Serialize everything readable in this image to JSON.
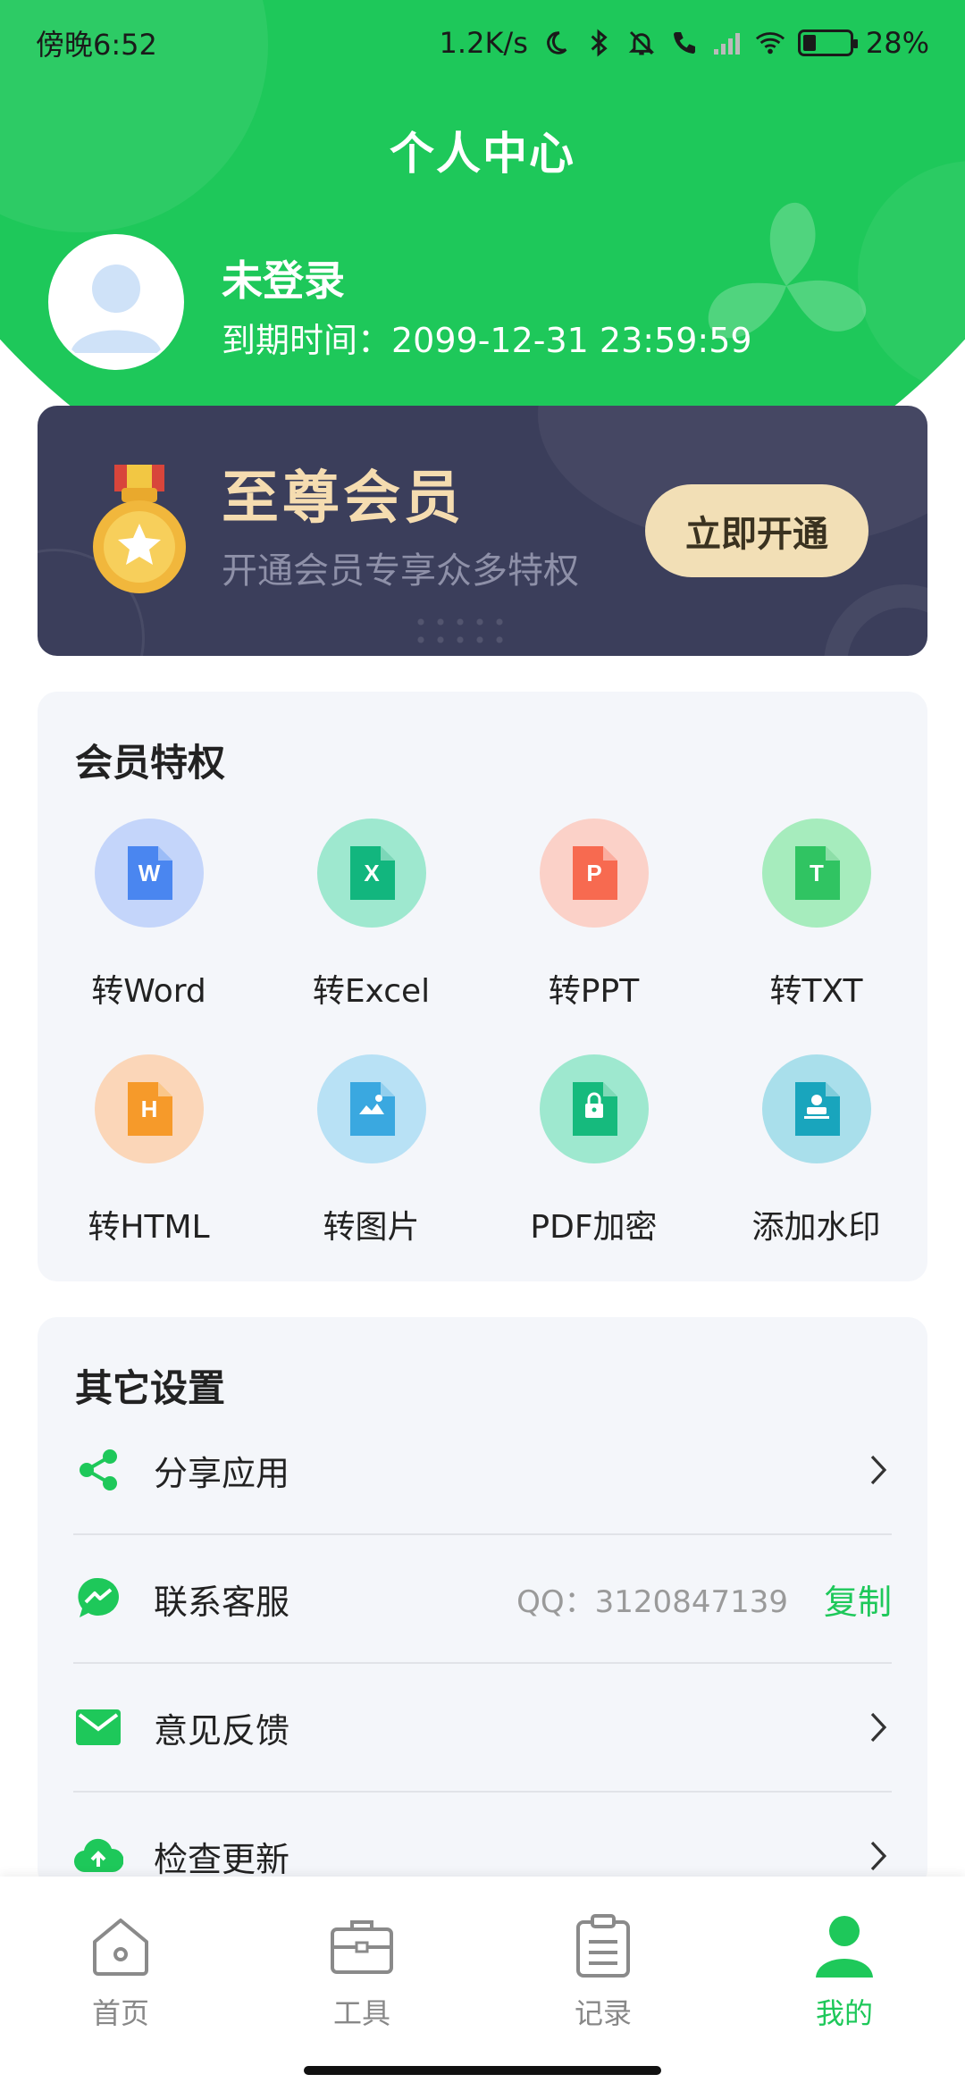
{
  "status_bar": {
    "time": "傍晚6:52",
    "network_speed": "1.2K/s",
    "battery_percent": "28%",
    "battery_level": 0.28,
    "icons": [
      "moon-icon",
      "bluetooth-icon",
      "mute-bell-icon",
      "call-icon",
      "signal-icon",
      "wifi-icon",
      "battery-icon"
    ]
  },
  "header": {
    "title": "个人中心"
  },
  "user": {
    "name": "未登录",
    "expiry": "到期时间：2099-12-31 23:59:59"
  },
  "vip": {
    "title": "至尊会员",
    "subtitle": "开通会员专享众多特权",
    "button_label": "立即开通",
    "colors": {
      "card": "#3b3e5b",
      "title": "#f5dcb0",
      "button": "#f2dfb6"
    }
  },
  "privileges": {
    "title": "会员特权",
    "items": [
      {
        "label": "转Word",
        "icon": "word-doc-icon",
        "glyph": "W",
        "bg": "#c4d5fa",
        "fg": "#4a86f0"
      },
      {
        "label": "转Excel",
        "icon": "excel-doc-icon",
        "glyph": "X",
        "bg": "#9ee8cf",
        "fg": "#12b67e"
      },
      {
        "label": "转PPT",
        "icon": "ppt-doc-icon",
        "glyph": "P",
        "bg": "#fbd1c8",
        "fg": "#f76a50"
      },
      {
        "label": "转TXT",
        "icon": "txt-doc-icon",
        "glyph": "T",
        "bg": "#a6ecbd",
        "fg": "#30c462"
      },
      {
        "label": "转HTML",
        "icon": "html-doc-icon",
        "glyph": "H",
        "bg": "#fbd6b8",
        "fg": "#f69a2a"
      },
      {
        "label": "转图片",
        "icon": "image-doc-icon",
        "glyph": "",
        "bg": "#b8e1f5",
        "fg": "#3aa8e0"
      },
      {
        "label": "PDF加密",
        "icon": "lock-doc-icon",
        "glyph": "",
        "bg": "#9ee8cf",
        "fg": "#16ba7d"
      },
      {
        "label": "添加水印",
        "icon": "watermark-doc-icon",
        "glyph": "",
        "bg": "#a9dfeb",
        "fg": "#19a5bd"
      }
    ]
  },
  "settings": {
    "title": "其它设置",
    "share_label": "分享应用",
    "contact_label": "联系客服",
    "contact_qq": "QQ：3120847139",
    "copy_label": "复制",
    "feedback_label": "意见反馈",
    "update_label": "检查更新"
  },
  "nav": {
    "home": "首页",
    "tools": "工具",
    "records": "记录",
    "mine": "我的",
    "active": "我的"
  },
  "accent_color": "#1ec85a"
}
